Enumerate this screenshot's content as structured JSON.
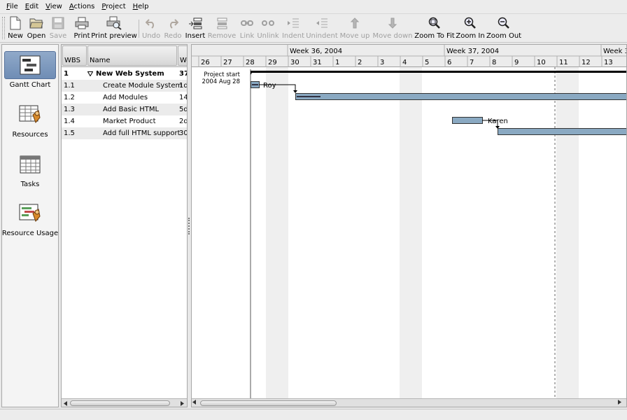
{
  "menu": {
    "file": {
      "u": "F",
      "rest": "ile"
    },
    "edit": {
      "u": "E",
      "rest": "dit"
    },
    "view": {
      "u": "V",
      "rest": "iew"
    },
    "actions": {
      "u": "A",
      "rest": "ctions"
    },
    "project": {
      "u": "P",
      "rest": "roject"
    },
    "help": {
      "u": "H",
      "rest": "elp"
    }
  },
  "toolbar": {
    "new": "New",
    "open": "Open",
    "save": "Save",
    "print": "Print",
    "print_preview": "Print preview",
    "undo": "Undo",
    "redo": "Redo",
    "insert": "Insert",
    "remove": "Remove",
    "link": "Link",
    "unlink": "Unlink",
    "indent": "Indent",
    "unindent": "Unindent",
    "move_up": "Move up",
    "move_down": "Move down",
    "zoom_to_fit": "Zoom To Fit",
    "zoom_in": "Zoom In",
    "zoom_out": "Zoom Out"
  },
  "sidebar": {
    "gantt_chart": "Gantt Chart",
    "resources": "Resources",
    "tasks": "Tasks",
    "resource_usage": "Resource Usage"
  },
  "table": {
    "columns": {
      "wbs": "WBS",
      "name": "Name",
      "work": "Wo"
    },
    "rows": [
      {
        "wbs": "1",
        "name": "New Web System",
        "work": "37"
      },
      {
        "wbs": "1.1",
        "name": "Create Module System",
        "work": "1d"
      },
      {
        "wbs": "1.2",
        "name": "Add Modules",
        "work": "14"
      },
      {
        "wbs": "1.3",
        "name": "Add Basic HTML",
        "work": "5d"
      },
      {
        "wbs": "1.4",
        "name": "Market Product",
        "work": "2d"
      },
      {
        "wbs": "1.5",
        "name": "Add full HTML support",
        "work": "30"
      }
    ]
  },
  "gantt": {
    "weeks": [
      {
        "label": "Week 36, 2004"
      },
      {
        "label": "Week 37, 2004"
      },
      {
        "label": "Week 3"
      }
    ],
    "days": [
      "26",
      "27",
      "28",
      "29",
      "30",
      "31",
      "1",
      "2",
      "3",
      "4",
      "5",
      "6",
      "7",
      "8",
      "9",
      "10",
      "11",
      "12",
      "13"
    ],
    "project_start_line1": "Project start",
    "project_start_line2": "2004 Aug 28",
    "resource_roy": "Roy",
    "resource_karen": "Karen"
  },
  "colors": {
    "bar_fill": "#8aa9c2",
    "summary": "#000000",
    "weekend_shade": "#efefef",
    "sidebar_selected": "#7a96bd"
  }
}
